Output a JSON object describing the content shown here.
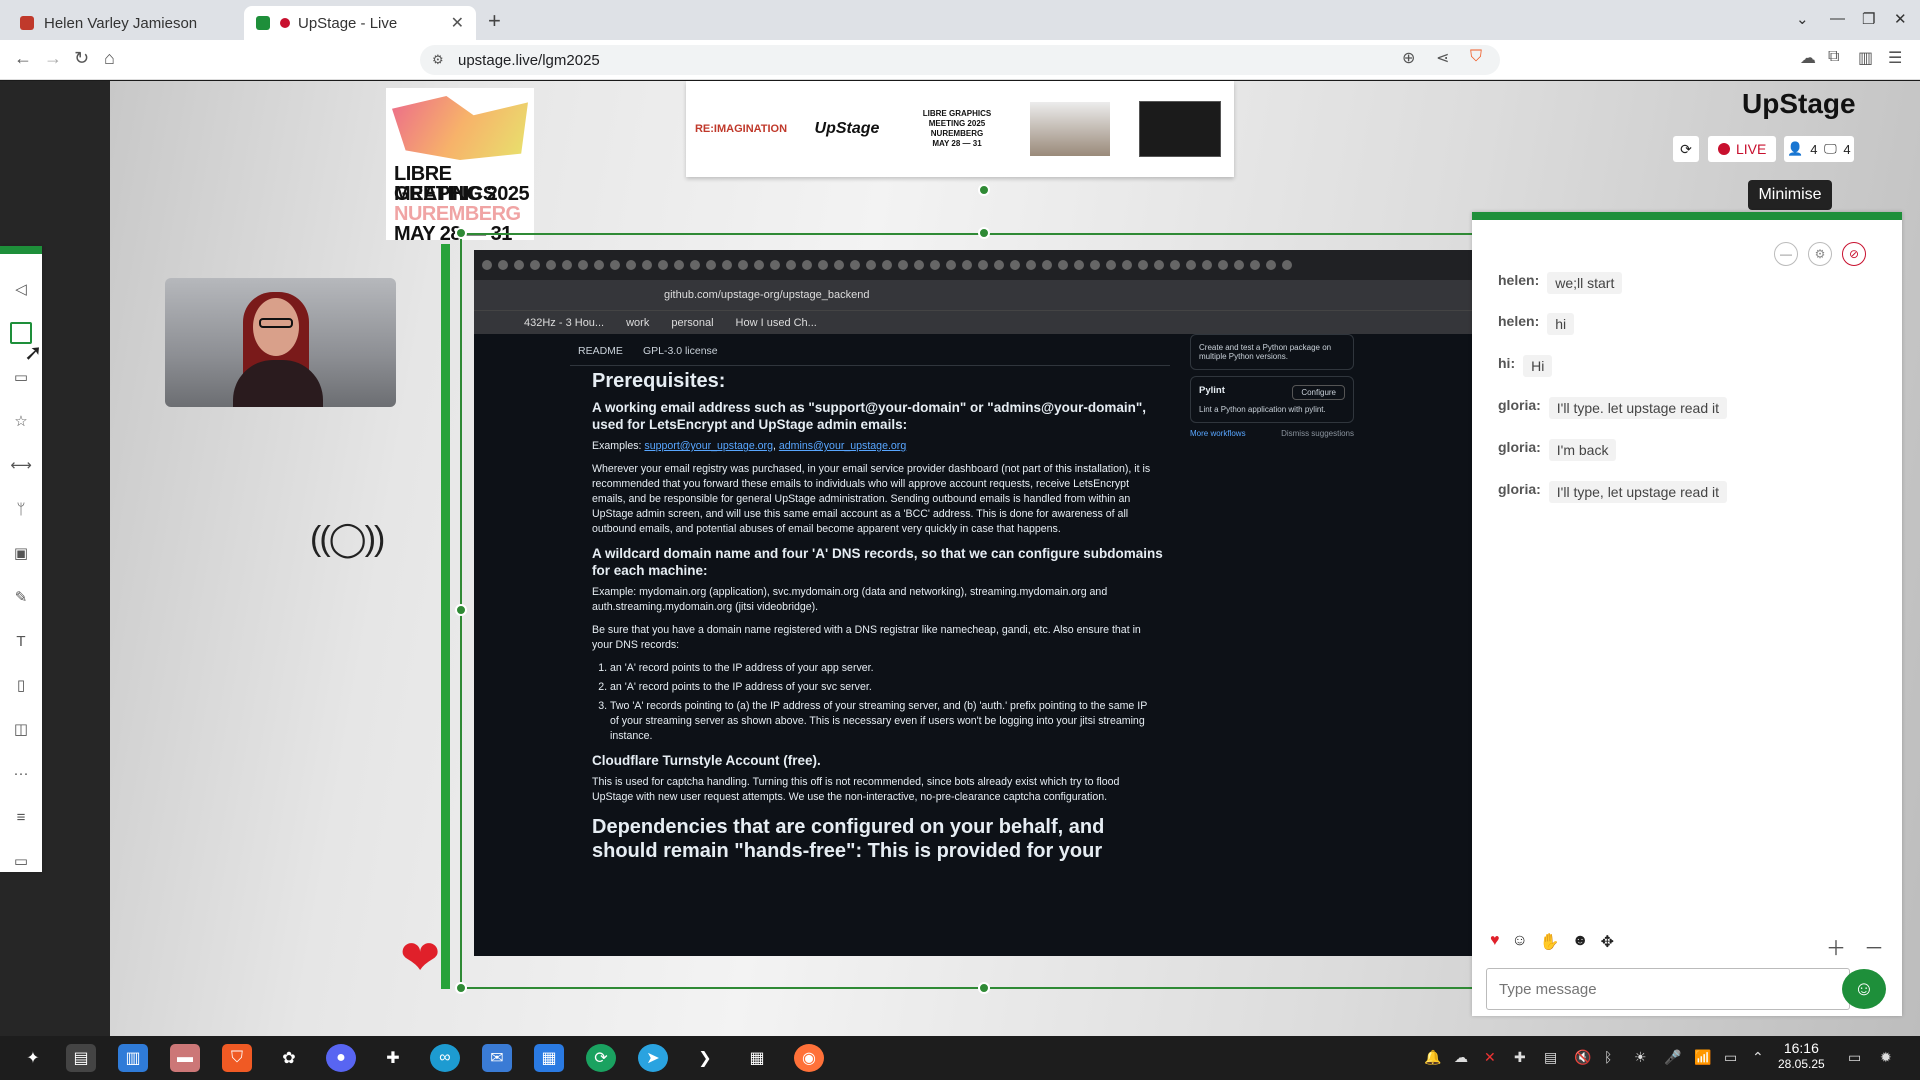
{
  "browser": {
    "tabs": [
      {
        "title": "Helen Varley Jamieson",
        "active": false
      },
      {
        "title": "UpStage - Live",
        "active": true
      }
    ],
    "url": "upstage.live/lgm2025"
  },
  "poster": {
    "lines": [
      "LIBRE GRAPHICS",
      "MEETING 2025",
      "NUREMBERG",
      "MAY 28 — 31"
    ]
  },
  "banner": {
    "reimagination": "RE:IMAGINATION",
    "upstage": "UpStage",
    "lgm": "LIBRE GRAPHICS MEETING 2025 NUREMBERG MAY 28 — 31"
  },
  "screen": {
    "url": "github.com/upstage-org/upstage_backend",
    "bookmarks": [
      "432Hz - 3 Hou...",
      "work",
      "personal",
      "How I used Ch..."
    ],
    "readme_tabs": [
      "README",
      "GPL-3.0 license"
    ],
    "h1": "Prerequisites:",
    "h3_email": "A working email address such as \"support@your-domain\" or \"admins@your-domain\", used for LetsEncrypt and UpStage admin emails:",
    "examples_label": "Examples:",
    "examples_link1": "support@your_upstage.org",
    "examples_link2": "admins@your_upstage.org",
    "p_email": "Wherever your email registry was purchased, in your email service provider dashboard (not part of this installation), it is recommended that you forward these emails to individuals who will approve account requests, receive LetsEncrypt emails, and be responsible for general UpStage administration. Sending outbound emails is handled from within an UpStage admin screen, and will use this same email account as a 'BCC' address. This is done for awareness of all outbound emails, and potential abuses of email become apparent very quickly in case that happens.",
    "h3_dns": "A wildcard domain name and four 'A' DNS records, so that we can configure subdomains for each machine:",
    "p_dns_example": "Example: mydomain.org (application), svc.mydomain.org (data and networking), streaming.mydomain.org and auth.streaming.mydomain.org (jitsi videobridge).",
    "p_dns": "Be sure that you have a domain name registered with a DNS registrar like namecheap, gandi, etc. Also ensure that in your DNS records:",
    "list": [
      "an 'A' record points to the IP address of your app server.",
      "an 'A' record points to the IP address of your svc server.",
      "Two 'A' records pointing to (a) the IP address of your streaming server, and (b) 'auth.' prefix pointing to the same IP of your streaming server as shown above. This is necessary even if users won't be logging into your jitsi streaming instance."
    ],
    "h3_turnstile": "Cloudflare Turnstyle Account (free).",
    "p_turnstile": "This is used for captcha handling. Turning this off is not recommended, since bots already exist which try to flood UpStage with new user request attempts. We use the non-interactive, no-pre-clearance captcha configuration.",
    "h2_deps": "Dependencies that are configured on your behalf, and should remain \"hands-free\": This is provided for your",
    "card1": "Create and test a Python package on multiple Python versions.",
    "card2_title": "Pylint",
    "card2_btn": "Configure",
    "card2_desc": "Lint a Python application with pylint.",
    "more_workflows": "More workflows",
    "dismiss": "Dismiss suggestions"
  },
  "panel": {
    "logo": "UpStage",
    "live_label": "LIVE",
    "players": "4",
    "screens": "4",
    "tooltip": "Minimise"
  },
  "chat": {
    "messages": [
      {
        "who": "helen:",
        "text": "we;ll start"
      },
      {
        "who": "helen:",
        "text": "hi"
      },
      {
        "who": "hi:",
        "text": "Hi"
      },
      {
        "who": "gloria:",
        "text": "I'll type. let upstage read it"
      },
      {
        "who": "gloria:",
        "text": "I'm back"
      },
      {
        "who": "gloria:",
        "text": "I'll type, let upstage read it"
      }
    ],
    "placeholder": "Type message"
  },
  "taskbar": {
    "time": "16:16",
    "date": "28.05.25"
  }
}
